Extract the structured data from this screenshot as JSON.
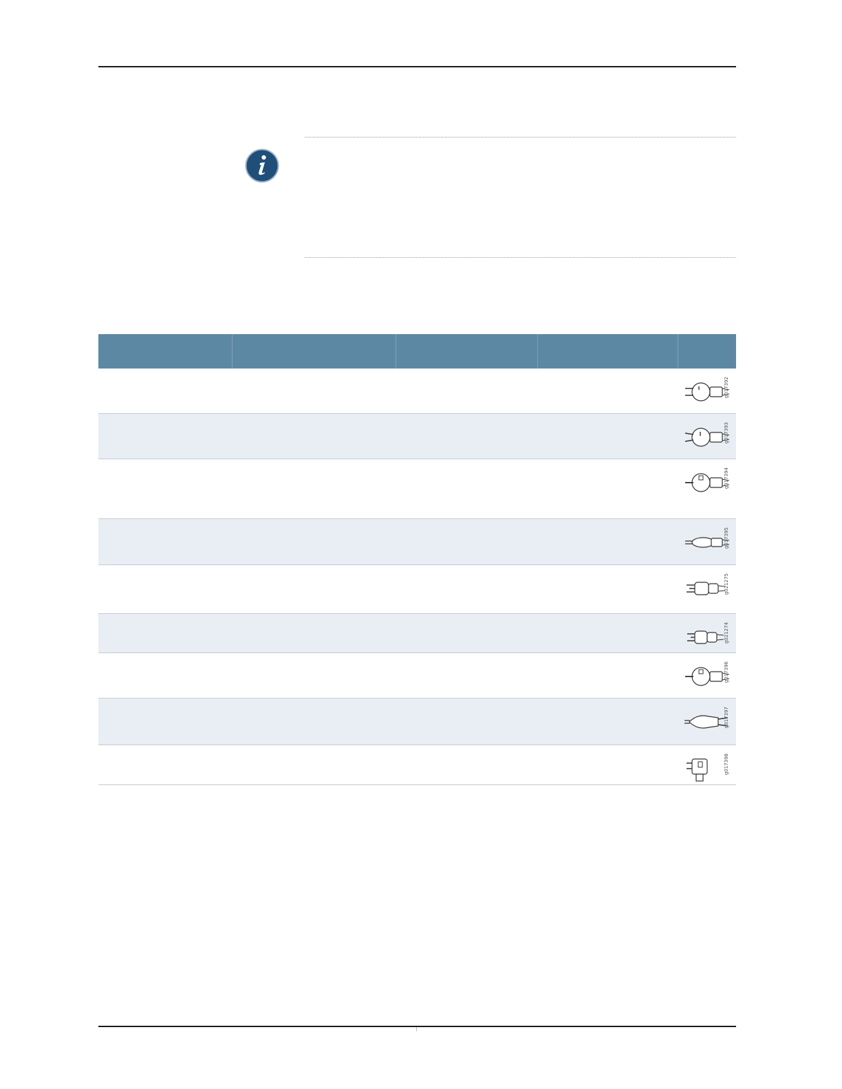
{
  "note": {
    "icon": "info-icon",
    "text": ""
  },
  "table": {
    "headers": [
      "",
      "",
      "",
      "",
      ""
    ],
    "rows": [
      {
        "cells": [
          "",
          "",
          "",
          ""
        ],
        "plug_icon": "plug-type-1-icon",
        "figure_id": "g017392"
      },
      {
        "cells": [
          "",
          "",
          "",
          ""
        ],
        "plug_icon": "plug-type-2-icon",
        "figure_id": "g017393"
      },
      {
        "cells": [
          "",
          "",
          "",
          ""
        ],
        "plug_icon": "plug-type-3-icon",
        "figure_id": "g017394"
      },
      {
        "cells": [
          "",
          "",
          "",
          ""
        ],
        "plug_icon": "plug-type-4-icon",
        "figure_id": "g017395"
      },
      {
        "cells": [
          "",
          "",
          "",
          ""
        ],
        "plug_icon": "plug-type-5-icon",
        "figure_id": "g021275"
      },
      {
        "cells": [
          "",
          "",
          "",
          ""
        ],
        "plug_icon": "plug-type-6-icon",
        "figure_id": "g021274"
      },
      {
        "cells": [
          "",
          "",
          "",
          ""
        ],
        "plug_icon": "plug-type-7-icon",
        "figure_id": "g017396"
      },
      {
        "cells": [
          "",
          "",
          "",
          ""
        ],
        "plug_icon": "plug-type-8-icon",
        "figure_id": "g017397"
      },
      {
        "cells": [
          "",
          "",
          "",
          ""
        ],
        "plug_icon": "plug-type-9-icon",
        "figure_id": "g017398"
      }
    ]
  },
  "colors": {
    "header_bg": "#5d88a4",
    "alt_row_bg": "#e8eef3",
    "info_icon_bg": "#1f4e79"
  }
}
